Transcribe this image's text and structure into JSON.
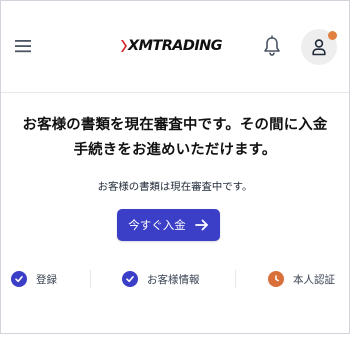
{
  "header": {
    "logo_text": "XMTRADING",
    "menu_icon": "hamburger-menu-icon",
    "bell_icon": "bell-icon",
    "account_icon": "user-icon",
    "notification_dot_color": "#e2813f"
  },
  "main": {
    "headline": "お客様の書類を現在審査中です。その間に入金\n手続きをお進めいただけます。",
    "subtext": "お客様の書類は現在審査中です。",
    "deposit_button": {
      "label": "今すぐ入金",
      "icon": "arrow-right-icon",
      "color": "#3b3ec6"
    }
  },
  "steps": [
    {
      "label": "登録",
      "status": "completed",
      "icon": "check-circle-icon",
      "color": "#3b3ec6"
    },
    {
      "label": "お客様情報",
      "status": "completed",
      "icon": "check-circle-icon",
      "color": "#3b3ec6"
    },
    {
      "label": "本人認証",
      "status": "pending",
      "icon": "clock-icon",
      "color": "#d9703a"
    }
  ]
}
